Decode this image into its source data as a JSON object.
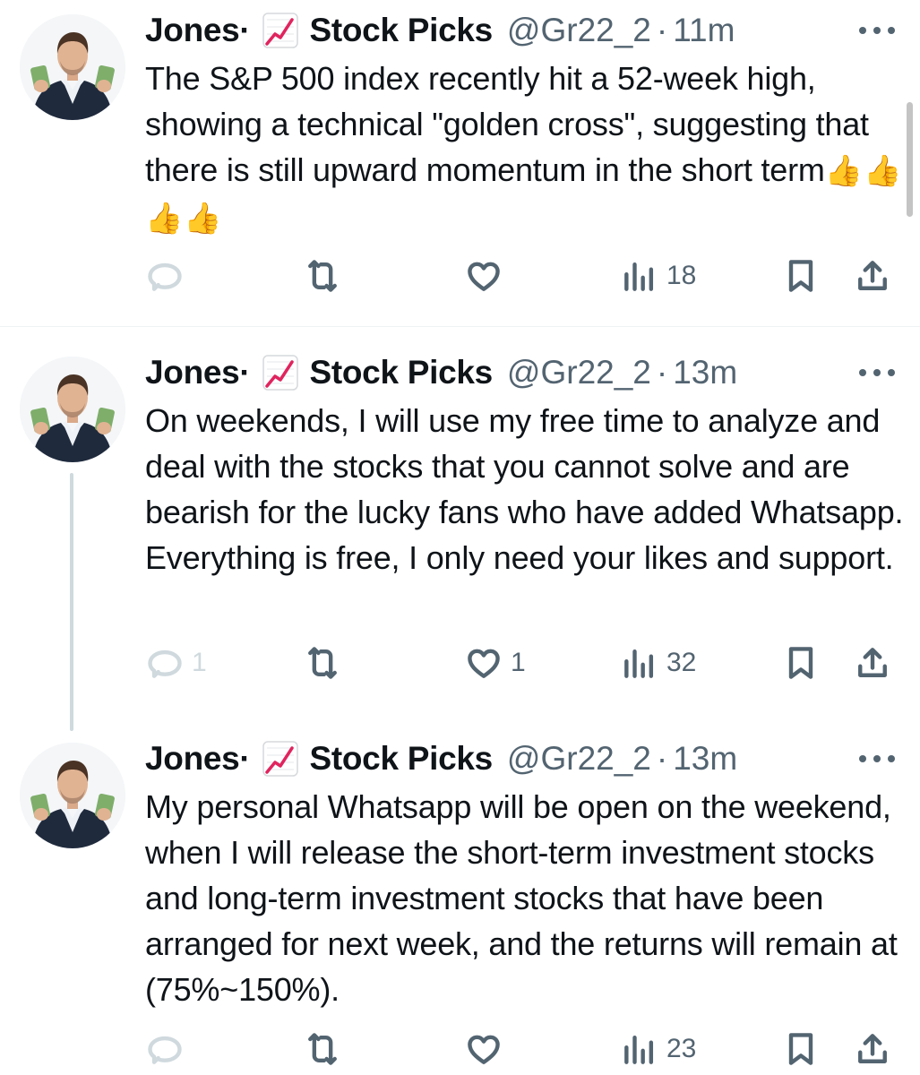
{
  "tweets": [
    {
      "name": "Jones·",
      "emoji_icon": "chart-increasing-icon",
      "handle_name": "Stock Picks",
      "handle": "@Gr22_2",
      "separator": "·",
      "time": "11m",
      "text": "The S&P 500 index recently hit a 52-week high, showing a technical \"golden cross\", suggesting that there is still upward momentum in the short term",
      "emoji_suffix": "👍👍👍👍",
      "replies": "",
      "reposts": "",
      "likes": "",
      "views": "18"
    },
    {
      "name": "Jones·",
      "emoji_icon": "chart-increasing-icon",
      "handle_name": "Stock Picks",
      "handle": "@Gr22_2",
      "separator": "·",
      "time": "13m",
      "text": "On weekends, I will use my free time to analyze and deal with the stocks that you cannot solve and are bearish for the lucky fans who have added Whatsapp. Everything is free, I only need your likes and support.",
      "replies": "1",
      "reposts": "",
      "likes": "1",
      "views": "32"
    },
    {
      "name": "Jones·",
      "emoji_icon": "chart-increasing-icon",
      "handle_name": "Stock Picks",
      "handle": "@Gr22_2",
      "separator": "·",
      "time": "13m",
      "text": "My personal Whatsapp will be open on the weekend, when I will release the short-term investment stocks and long-term investment stocks that have been arranged for next week, and the returns will remain at (75%~150%).",
      "replies": "",
      "reposts": "",
      "likes": "",
      "views": "23"
    }
  ],
  "colors": {
    "text": "#0f1419",
    "secondary": "#536471",
    "divider": "#eff3f4",
    "thread_line": "#cfd9de"
  }
}
